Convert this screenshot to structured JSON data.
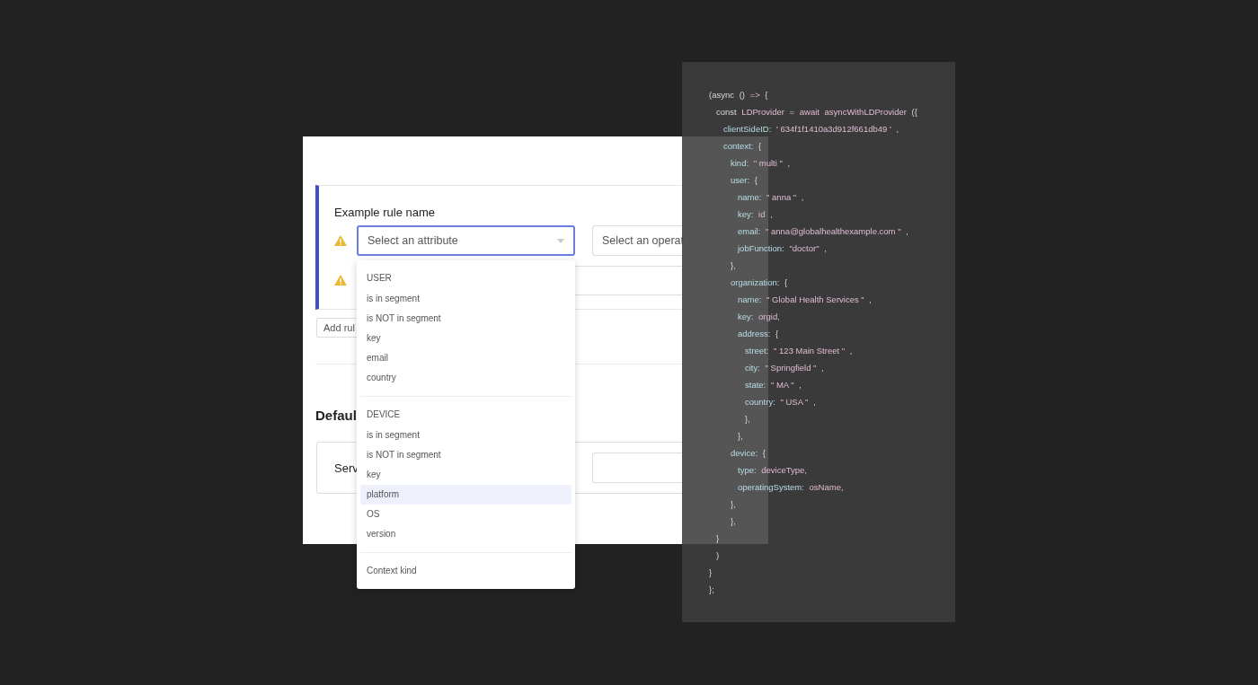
{
  "rule": {
    "title": "Example rule name",
    "attribute_field": {
      "placeholder": "Select an attribute"
    },
    "operator_field": {
      "placeholder": "Select an operat"
    },
    "warnings": [
      true,
      true
    ]
  },
  "add_rule_button": "Add rul",
  "default_section": {
    "heading": "Defaul",
    "label": "Serv"
  },
  "attribute_menu": {
    "groups": [
      {
        "label": "USER",
        "items": [
          {
            "text": "is in segment",
            "selected": false
          },
          {
            "text": "is NOT in segment",
            "selected": false
          },
          {
            "text": "key",
            "selected": false
          },
          {
            "text": "email",
            "selected": false
          },
          {
            "text": "country",
            "selected": false
          }
        ]
      },
      {
        "label": "DEVICE",
        "items": [
          {
            "text": "is in segment",
            "selected": false
          },
          {
            "text": "is NOT in segment",
            "selected": false
          },
          {
            "text": "key",
            "selected": false
          },
          {
            "text": "platform",
            "selected": true
          },
          {
            "text": "OS",
            "selected": false
          },
          {
            "text": "version",
            "selected": false
          }
        ]
      }
    ],
    "footer": "Context kind"
  },
  "code": [
    {
      "parts": [
        {
          "text": "(async",
          "kind": "plain"
        },
        {
          "text": "()",
          "kind": "plain"
        },
        {
          "text": "=>",
          "kind": "keyword"
        },
        {
          "text": "{",
          "kind": "plain"
        }
      ],
      "children": [
        {
          "parts": [
            {
              "text": "const",
              "kind": "plain"
            },
            {
              "text": "LDProvider",
              "kind": "value"
            },
            {
              "text": "=",
              "kind": "value"
            },
            {
              "text": "await",
              "kind": "value"
            },
            {
              "text": "asyncWithLDProvider",
              "kind": "value"
            },
            {
              "text": "({",
              "kind": "plain"
            }
          ],
          "children": [
            {
              "parts": [
                {
                  "text": "clientSideID:",
                  "kind": "key"
                },
                {
                  "text": "' 634f1f1410a3d912f661db49 '",
                  "kind": "value"
                },
                {
                  "text": ",",
                  "kind": "plain"
                }
              ]
            },
            {
              "parts": [
                {
                  "text": "context:",
                  "kind": "key"
                },
                {
                  "text": "{",
                  "kind": "plain"
                }
              ],
              "children": [
                {
                  "parts": [
                    {
                      "text": "kind:",
                      "kind": "key"
                    },
                    {
                      "text": "\" multi \"",
                      "kind": "value"
                    },
                    {
                      "text": ",",
                      "kind": "plain"
                    }
                  ]
                },
                {
                  "parts": [
                    {
                      "text": "user:",
                      "kind": "key"
                    },
                    {
                      "text": "{",
                      "kind": "plain"
                    }
                  ],
                  "children": [
                    {
                      "parts": [
                        {
                          "text": "name:",
                          "kind": "key"
                        },
                        {
                          "text": "\" anna \"",
                          "kind": "value"
                        },
                        {
                          "text": ",",
                          "kind": "plain"
                        }
                      ]
                    },
                    {
                      "parts": [
                        {
                          "text": "key:",
                          "kind": "key"
                        },
                        {
                          "text": "id",
                          "kind": "value"
                        },
                        {
                          "text": ",",
                          "kind": "plain"
                        }
                      ]
                    },
                    {
                      "parts": [
                        {
                          "text": "email:",
                          "kind": "key"
                        },
                        {
                          "text": "\" anna@globalhealthexample.com \"",
                          "kind": "value"
                        },
                        {
                          "text": ",",
                          "kind": "plain"
                        }
                      ]
                    },
                    {
                      "parts": [
                        {
                          "text": "jobFunction:",
                          "kind": "key"
                        },
                        {
                          "text": "\"doctor\"",
                          "kind": "value"
                        },
                        {
                          "text": ",",
                          "kind": "plain"
                        }
                      ]
                    }
                  ]
                },
                {
                  "parts": [
                    {
                      "text": "},",
                      "kind": "plain"
                    }
                  ]
                },
                {
                  "parts": [
                    {
                      "text": "organization:",
                      "kind": "key"
                    },
                    {
                      "text": "{",
                      "kind": "plain"
                    }
                  ],
                  "children": [
                    {
                      "parts": [
                        {
                          "text": "name:",
                          "kind": "key"
                        },
                        {
                          "text": "\" Global Health Services \"",
                          "kind": "value"
                        },
                        {
                          "text": ",",
                          "kind": "plain"
                        }
                      ]
                    },
                    {
                      "parts": [
                        {
                          "text": "key:",
                          "kind": "key"
                        },
                        {
                          "text": "orgid,",
                          "kind": "value"
                        }
                      ]
                    },
                    {
                      "parts": [
                        {
                          "text": "address:",
                          "kind": "key"
                        },
                        {
                          "text": "{",
                          "kind": "plain"
                        }
                      ],
                      "children": [
                        {
                          "parts": [
                            {
                              "text": "street:",
                              "kind": "key"
                            },
                            {
                              "text": "\" 123 Main Street \"",
                              "kind": "value"
                            },
                            {
                              "text": ",",
                              "kind": "plain"
                            }
                          ]
                        },
                        {
                          "parts": [
                            {
                              "text": "city:",
                              "kind": "key"
                            },
                            {
                              "text": "\" Springfield \"",
                              "kind": "value"
                            },
                            {
                              "text": ",",
                              "kind": "plain"
                            }
                          ]
                        },
                        {
                          "parts": [
                            {
                              "text": "state:",
                              "kind": "key"
                            },
                            {
                              "text": "\" MA \"",
                              "kind": "value"
                            },
                            {
                              "text": ",",
                              "kind": "plain"
                            }
                          ]
                        },
                        {
                          "parts": [
                            {
                              "text": "country:",
                              "kind": "key"
                            },
                            {
                              "text": "\" USA \"",
                              "kind": "value"
                            },
                            {
                              "text": ",",
                              "kind": "plain"
                            }
                          ]
                        },
                        {
                          "parts": [
                            {
                              "text": "},",
                              "kind": "plain"
                            }
                          ]
                        }
                      ]
                    },
                    {
                      "parts": [
                        {
                          "text": "},",
                          "kind": "plain"
                        }
                      ]
                    }
                  ]
                },
                {
                  "parts": [
                    {
                      "text": "device:",
                      "kind": "key"
                    },
                    {
                      "text": "{",
                      "kind": "plain"
                    }
                  ],
                  "children": [
                    {
                      "parts": [
                        {
                          "text": "type:",
                          "kind": "key"
                        },
                        {
                          "text": "deviceType,",
                          "kind": "value"
                        }
                      ]
                    },
                    {
                      "parts": [
                        {
                          "text": "operatingSystem:",
                          "kind": "key"
                        },
                        {
                          "text": "osName,",
                          "kind": "value"
                        }
                      ]
                    }
                  ]
                },
                {
                  "parts": [
                    {
                      "text": "},",
                      "kind": "plain"
                    }
                  ]
                },
                {
                  "parts": [
                    {
                      "text": "},",
                      "kind": "plain"
                    }
                  ]
                }
              ]
            }
          ]
        },
        {
          "parts": [
            {
              "text": "}",
              "kind": "plain"
            }
          ]
        },
        {
          "parts": [
            {
              "text": ")",
              "kind": "plain"
            }
          ]
        }
      ]
    },
    {
      "parts": [
        {
          "text": "}",
          "kind": "plain"
        }
      ]
    },
    {
      "parts": [
        {
          "text": "};",
          "kind": "plain"
        }
      ]
    }
  ]
}
